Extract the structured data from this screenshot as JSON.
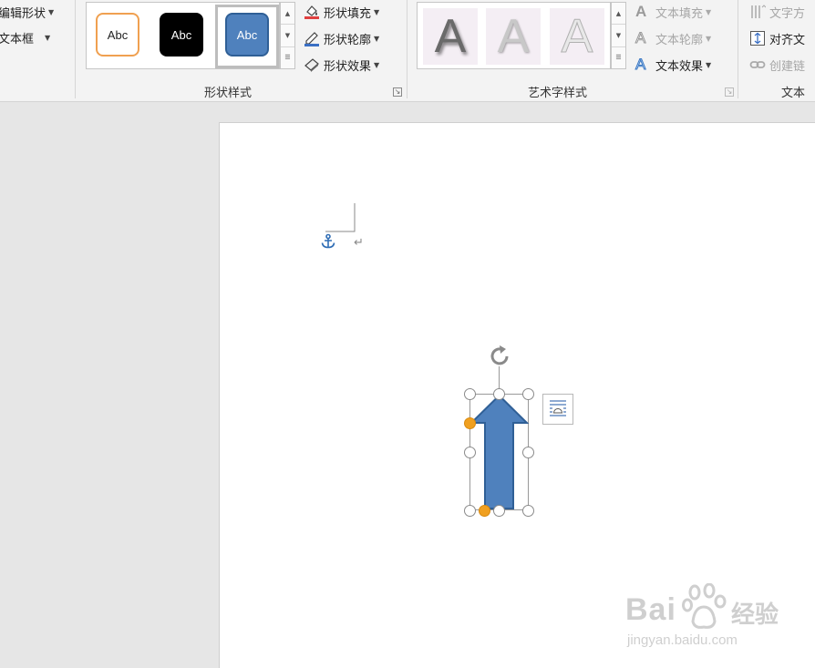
{
  "insert_shapes": {
    "edit_shape_label": "编辑形状",
    "text_box_label": "文本框"
  },
  "shape_styles": {
    "group_label": "形状样式",
    "tiles": [
      {
        "text": "Abc",
        "fill": "#ffffff",
        "border": "#f0a050",
        "color": "#222222"
      },
      {
        "text": "Abc",
        "fill": "#000000",
        "border": "#000000",
        "color": "#ffffff"
      },
      {
        "text": "Abc",
        "fill": "#4f81bd",
        "border": "#2f5f96",
        "color": "#ffffff"
      }
    ],
    "fill_label": "形状填充",
    "outline_label": "形状轮廓",
    "effects_label": "形状效果"
  },
  "wordart_styles": {
    "group_label": "艺术字样式",
    "tiles": [
      "A",
      "A",
      "A"
    ],
    "text_fill_label": "文本填充",
    "text_outline_label": "文本轮廓",
    "text_effects_label": "文本效果"
  },
  "text_group": {
    "group_label": "文本",
    "text_direction_label": "文字方",
    "align_text_label": "对齐文",
    "create_link_label": "创建链"
  },
  "document": {
    "paragraph_mark": "↵",
    "anchor_icon": "anchor-icon",
    "shape": {
      "type": "up-arrow",
      "fill": "#4f81bd",
      "outline": "#2f5f96"
    }
  },
  "colors": {
    "ribbon_bg": "#f3f3f3",
    "accent_blue": "#4f81bd",
    "handle_yellow": "#f0a020"
  },
  "watermark": {
    "brand": "Bai",
    "brand_suffix": "经验",
    "url": "jingyan.baidu.com"
  }
}
